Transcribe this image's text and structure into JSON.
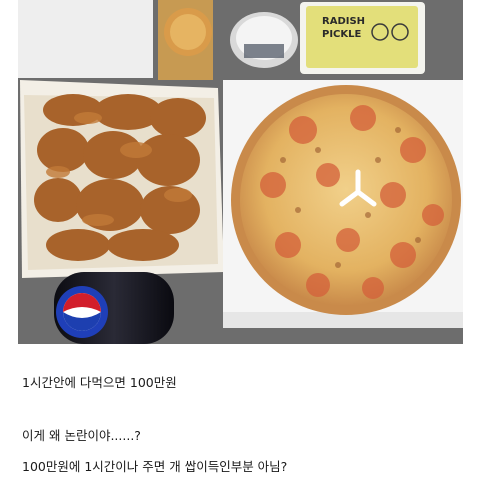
{
  "photo": {
    "pickle_label_line1": "RADISH",
    "pickle_label_line2": "PICKLE"
  },
  "post": {
    "line1": "1시간안에 다먹으면 100만원",
    "line2": "이게 왜 논란이야......?",
    "line3": "100만원에 1시간이나 주면 개 쌉이득인부분 아님?"
  },
  "colors": {
    "table": "#6e6e6e",
    "pizza_crust": "#c98a4a",
    "chicken": "#a8632b",
    "text": "#1a1a1a"
  }
}
